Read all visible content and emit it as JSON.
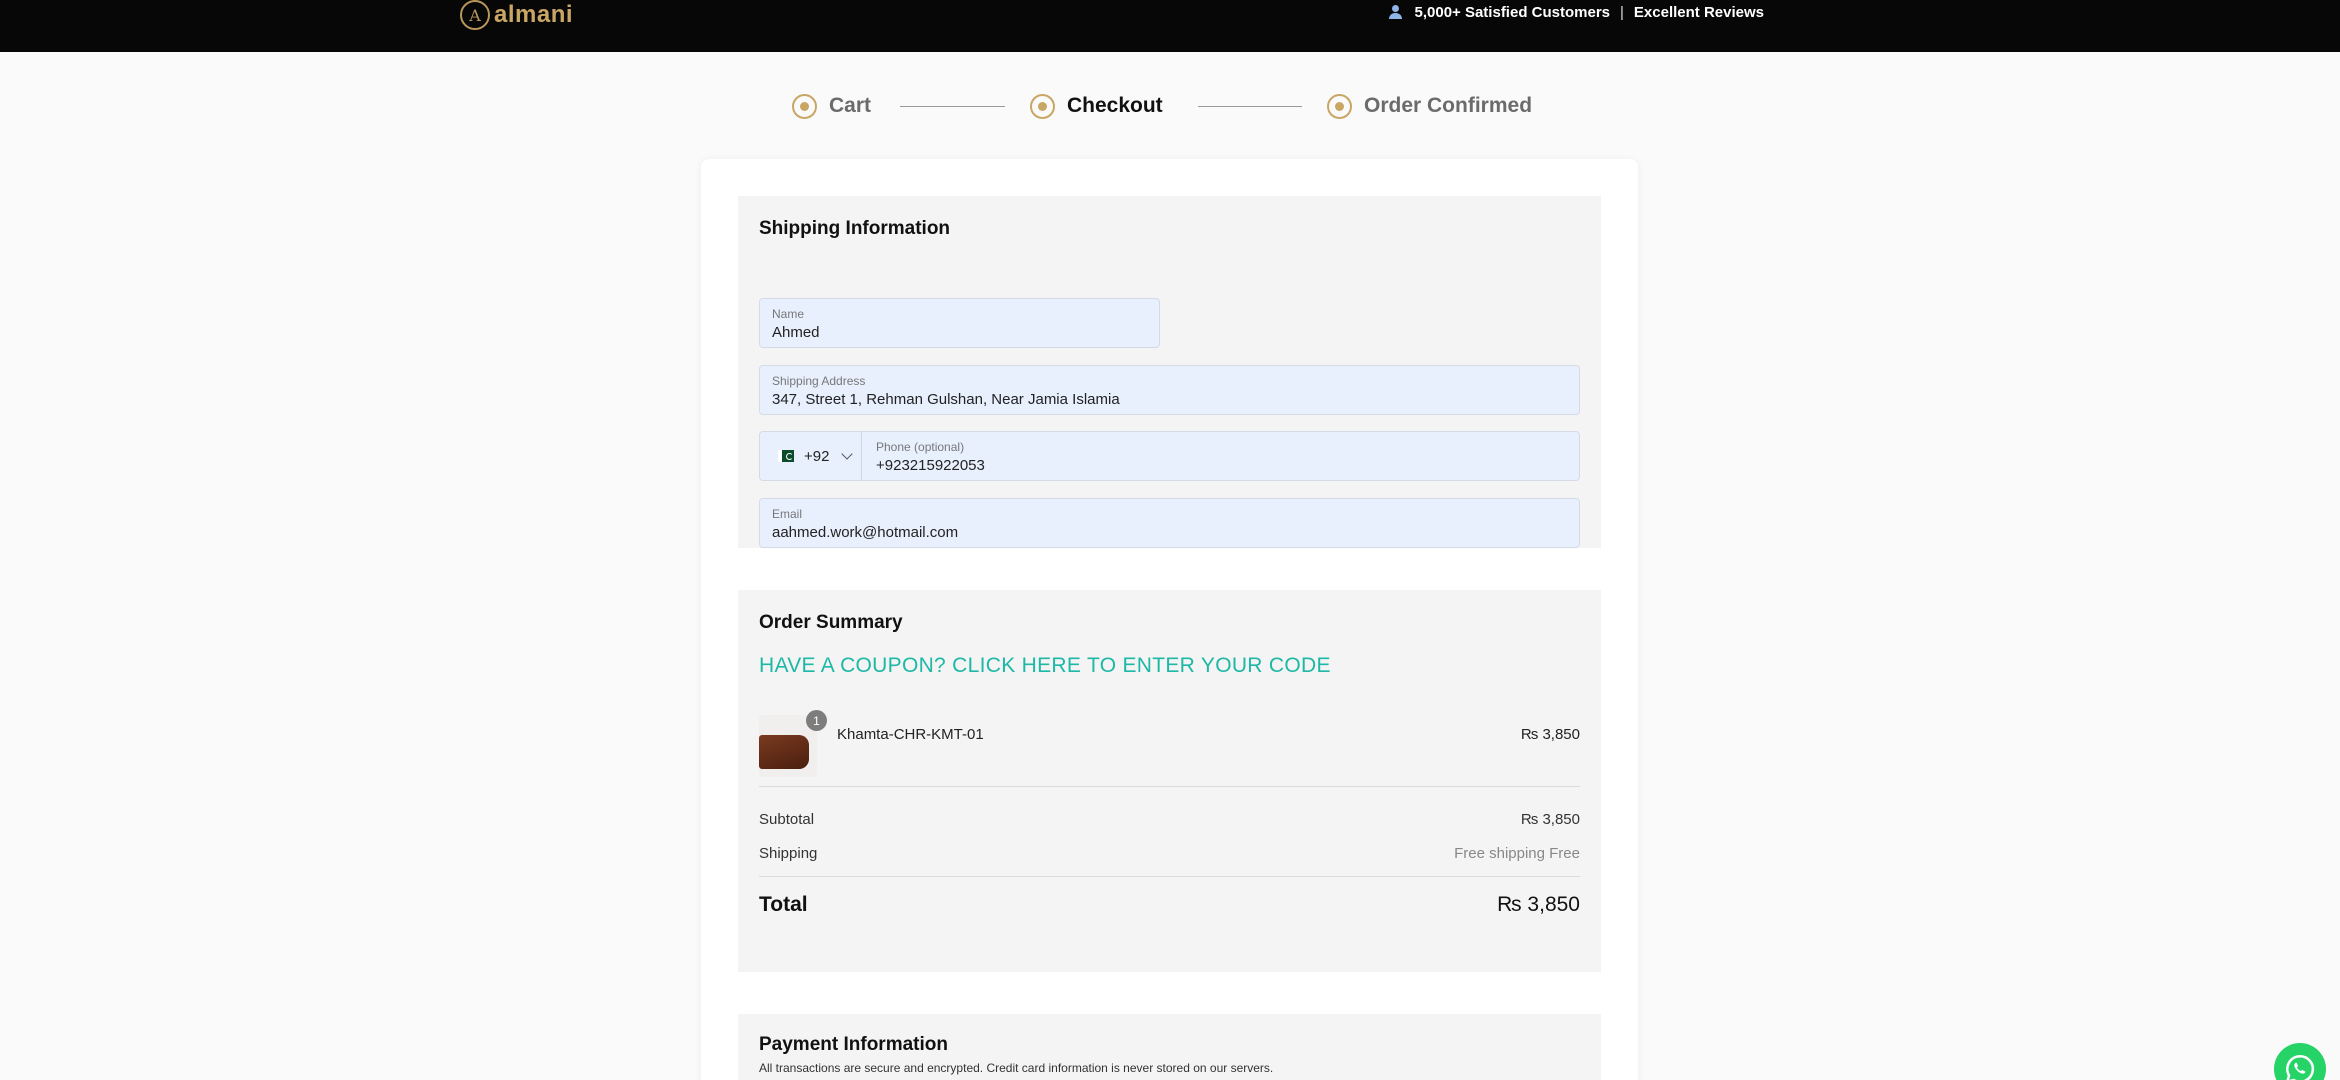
{
  "header": {
    "logo_mark": "A",
    "logo_text": "almani",
    "trust_customers": "5,000+ Satisfied Customers",
    "trust_separator": "|",
    "trust_reviews": "Excellent Reviews"
  },
  "stepper": {
    "steps": [
      {
        "label": "Cart",
        "state": "done"
      },
      {
        "label": "Checkout",
        "state": "current"
      },
      {
        "label": "Order Confirmed",
        "state": "upcoming"
      }
    ]
  },
  "shipping": {
    "title": "Shipping Information",
    "name": {
      "label": "Name",
      "value": "Ahmed"
    },
    "address": {
      "label": "Shipping Address",
      "value": "347, Street 1, Rehman Gulshan, Near Jamia Islamia"
    },
    "phone": {
      "country_code": "+92",
      "label": "Phone (optional)",
      "value": "+923215922053"
    },
    "email": {
      "label": "Email",
      "value": "aahmed.work@hotmail.com"
    }
  },
  "order_summary": {
    "title": "Order Summary",
    "coupon_link": "HAVE A COUPON? CLICK HERE TO ENTER YOUR CODE",
    "items": [
      {
        "name": "Khamta-CHR-KMT-01",
        "quantity": "1",
        "price": "₨ 3,850"
      }
    ],
    "subtotal_label": "Subtotal",
    "subtotal_value": "₨ 3,850",
    "shipping_label": "Shipping",
    "shipping_value": "Free shipping Free",
    "total_label": "Total",
    "total_value": "₨ 3,850"
  },
  "payment": {
    "title": "Payment Information",
    "note": "All transactions are secure and encrypted. Credit card information is never stored on our servers."
  },
  "colors": {
    "accent_gold": "#c9a664",
    "coupon_teal": "#1eb8a6",
    "field_bg": "#e8f0fe",
    "whatsapp_green": "#25d366"
  }
}
